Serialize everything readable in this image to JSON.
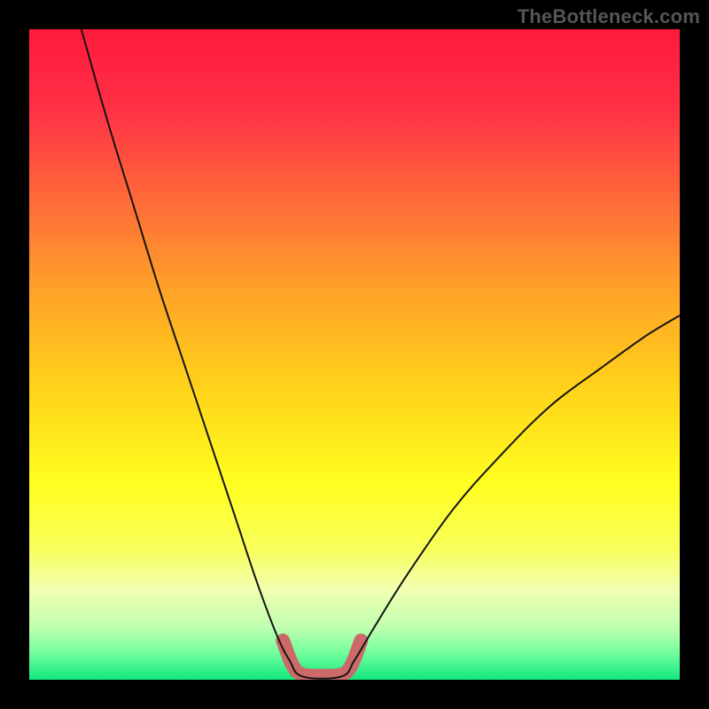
{
  "watermark": "TheBottleneck.com",
  "chart_data": {
    "type": "line",
    "title": "",
    "xlabel": "",
    "ylabel": "",
    "xlim": [
      0,
      100
    ],
    "ylim": [
      0,
      100
    ],
    "background_gradient": {
      "stops": [
        {
          "offset": 0.0,
          "color": "#ff1a3a"
        },
        {
          "offset": 0.12,
          "color": "#ff3046"
        },
        {
          "offset": 0.25,
          "color": "#ff653a"
        },
        {
          "offset": 0.4,
          "color": "#ffa228"
        },
        {
          "offset": 0.55,
          "color": "#ffd21a"
        },
        {
          "offset": 0.7,
          "color": "#ffff20"
        },
        {
          "offset": 0.8,
          "color": "#f8ff5c"
        },
        {
          "offset": 0.86,
          "color": "#f2ffb0"
        },
        {
          "offset": 0.92,
          "color": "#bfffb0"
        },
        {
          "offset": 0.96,
          "color": "#70ff9c"
        },
        {
          "offset": 1.0,
          "color": "#12e880"
        }
      ]
    },
    "series": [
      {
        "name": "bottleneck-curve",
        "color": "#141414",
        "width": 2,
        "points": [
          {
            "x": 8,
            "y": 100
          },
          {
            "x": 12,
            "y": 86
          },
          {
            "x": 16,
            "y": 73
          },
          {
            "x": 20,
            "y": 60
          },
          {
            "x": 24,
            "y": 48
          },
          {
            "x": 28,
            "y": 36
          },
          {
            "x": 32,
            "y": 24
          },
          {
            "x": 35,
            "y": 15
          },
          {
            "x": 38,
            "y": 7
          },
          {
            "x": 40,
            "y": 3
          },
          {
            "x": 42,
            "y": 0.5
          },
          {
            "x": 48,
            "y": 0.5
          },
          {
            "x": 50,
            "y": 3
          },
          {
            "x": 53,
            "y": 8
          },
          {
            "x": 58,
            "y": 16
          },
          {
            "x": 65,
            "y": 26
          },
          {
            "x": 72,
            "y": 34
          },
          {
            "x": 80,
            "y": 42
          },
          {
            "x": 88,
            "y": 48
          },
          {
            "x": 95,
            "y": 53
          },
          {
            "x": 100,
            "y": 56
          }
        ]
      },
      {
        "name": "optimal-zone",
        "color": "#cc6a6a",
        "width": 16,
        "linecap": "round",
        "points": [
          {
            "x": 39,
            "y": 6
          },
          {
            "x": 40.5,
            "y": 2.2
          },
          {
            "x": 42,
            "y": 0.8
          },
          {
            "x": 45,
            "y": 0.6
          },
          {
            "x": 48,
            "y": 0.8
          },
          {
            "x": 49.5,
            "y": 2.2
          },
          {
            "x": 51,
            "y": 6
          }
        ]
      }
    ]
  }
}
